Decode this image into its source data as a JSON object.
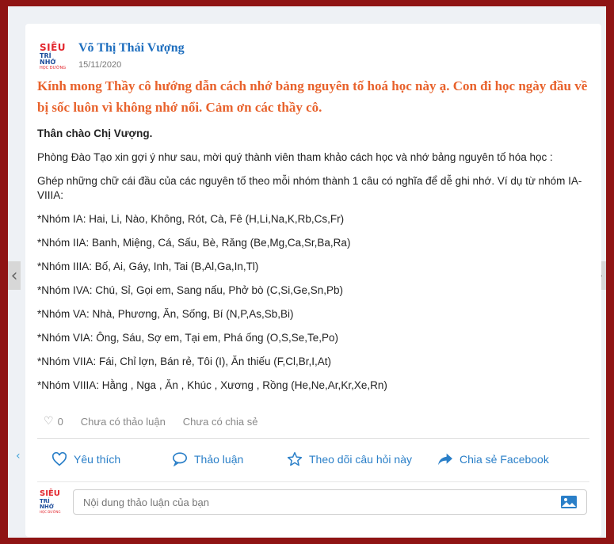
{
  "post": {
    "author": "Võ Thị Thái Vượng",
    "date": "15/11/2020",
    "question": "Kính mong Thầy cô hướng dẫn cách nhớ bảng nguyên tố hoá học này ạ. Con đi học ngày đầu về bị sốc luôn vì không nhớ nổi. Cảm ơn các thầy cô.",
    "logo": {
      "line1": "SIÊU",
      "line2": "TRÍ NHỚ",
      "line3": "HỌC ĐƯỜNG"
    }
  },
  "answer": {
    "greeting": "Thân chào Chị Vượng.",
    "intro": "Phòng Đào Tạo xin gợi ý như sau, mời quý thành viên tham khảo cách học và nhớ bảng nguyên tố hóa học :",
    "method": "Ghép những chữ cái đầu của các nguyên tố theo mỗi nhóm thành 1 câu có nghĩa để dễ ghi nhớ. Ví dụ từ nhóm IA-VIIIA:",
    "groups": [
      "*Nhóm IA: Hai, Li, Nào, Không, Rót, Cà, Fê (H,Li,Na,K,Rb,Cs,Fr)",
      "*Nhóm IIA: Banh, Miệng, Cá, Sấu, Bè, Răng (Be,Mg,Ca,Sr,Ba,Ra)",
      "*Nhóm IIIA: Bố, Ai, Gáy, Inh, Tai (B,Al,Ga,In,Tl)",
      "*Nhóm IVA: Chú, Sỉ, Gọi em, Sang nấu, Phở bò (C,Si,Ge,Sn,Pb)",
      "*Nhóm VA: Nhà, Phương, Ăn, Sống, Bí (N,P,As,Sb,Bi)",
      "*Nhóm VIA: Ông, Sáu, Sợ em, Tại em, Phá ống (O,S,Se,Te,Po)",
      "*Nhóm VIIA: Fái, Chỉ lợn, Bán rẻ, Tôi (I), Ăn thiếu (F,Cl,Br,I,At)",
      "*Nhóm VIIIA: Hằng , Nga , Ăn , Khúc , Xương , Rồng (He,Ne,Ar,Kr,Xe,Rn)"
    ]
  },
  "stats": {
    "likes": "0",
    "discussion": "Chưa có thảo luận",
    "shares": "Chưa có chia sẻ"
  },
  "actions": {
    "like": "Yêu thích",
    "discuss": "Thảo luận",
    "follow": "Theo dõi câu hỏi này",
    "share": "Chia sẻ Facebook"
  },
  "comment": {
    "placeholder": "Nội dung thảo luận của bạn"
  },
  "colors": {
    "frame": "#8f1414",
    "author": "#1f6fbf",
    "question": "#e8622c",
    "action": "#2a7fc8"
  }
}
